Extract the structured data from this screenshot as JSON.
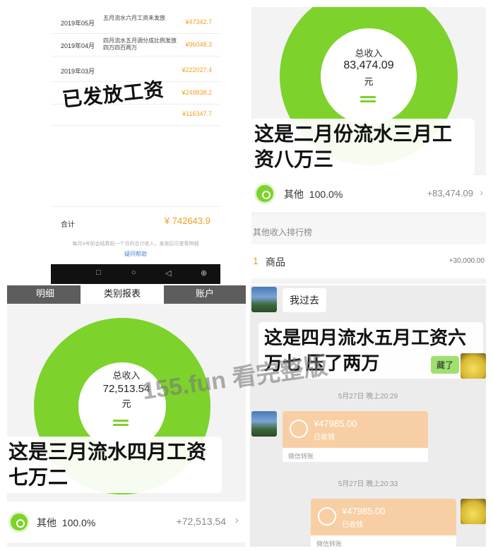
{
  "salary_table": {
    "rows": [
      {
        "month": "2019年05月",
        "desc": "五月流水六月工资未发放",
        "amount": "¥47342.7"
      },
      {
        "month": "2019年04月",
        "desc": "四月流水五月调分成比例发放四万四百两万",
        "amount": "¥96048.3"
      },
      {
        "month": "2019年03月",
        "desc": "",
        "amount": "¥222027.4"
      },
      {
        "month": "",
        "desc": "",
        "amount": "¥249838.2"
      },
      {
        "month": "",
        "desc": "",
        "amount": "¥116347.7"
      }
    ],
    "overlay_text": "已发放工资",
    "total_label": "合计",
    "total_value": "¥ 742643.9",
    "note": "每月4号前会结算前一个月的合计收入，发放后可查看明细",
    "help_link": "疑问帮助",
    "nav_icons": [
      "□",
      "○",
      "◁",
      "⊕"
    ]
  },
  "feb_panel": {
    "total_label": "总收入",
    "total_value": "83,474.09",
    "unit": "元",
    "caption": "这是二月份流水三月工资八万三",
    "other_label": "其他",
    "other_percent": "100.0%",
    "other_value": "+83,474.09",
    "chevron": "›",
    "ranking_title": "其他收入排行榜",
    "rank_number": "1",
    "rank_name": "商品",
    "rank_value": "+30,000.00",
    "percent_value": 1.0,
    "ring_color": "#7dd22c"
  },
  "mar_panel": {
    "tabs": [
      "明细",
      "类别报表",
      "账户"
    ],
    "active_tab": "类别报表",
    "total_label": "总收入",
    "total_value": "72,513.54",
    "unit": "元",
    "caption": "这是三月流水四月工资七万二",
    "other_label": "其他",
    "other_percent": "100.0%",
    "other_value": "+72,513.54",
    "chevron": "›",
    "percent_value": 1.0,
    "ring_color": "#7dd22c"
  },
  "chat_panel": {
    "message_in": "我过去",
    "caption": "这是四月流水五月工资六万七 压了两万",
    "green_reply": "藏了",
    "timestamp_1": "5月27日 晚上20:29",
    "transfer_1": {
      "amount": "¥47985.00",
      "status": "已收钱",
      "footer": "微信转账"
    },
    "timestamp_2": "5月27日 晚上20:33",
    "transfer_2": {
      "amount": "¥47985.00",
      "status": "已收钱",
      "footer": "微信转账"
    }
  },
  "watermark": "155.fun 看完整版"
}
